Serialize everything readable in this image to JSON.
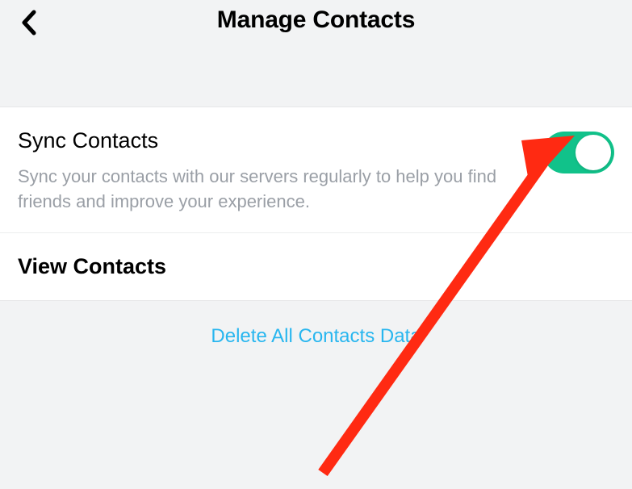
{
  "header": {
    "title": "Manage Contacts"
  },
  "sync": {
    "title": "Sync Contacts",
    "description": "Sync your contacts with our servers regularly to help you find friends and improve your experience.",
    "enabled": true
  },
  "view": {
    "title": "View Contacts"
  },
  "delete": {
    "label": "Delete All Contacts Data"
  },
  "colors": {
    "toggle_on": "#11c28a",
    "link": "#28b6ef",
    "annotation": "#ff2a12"
  }
}
